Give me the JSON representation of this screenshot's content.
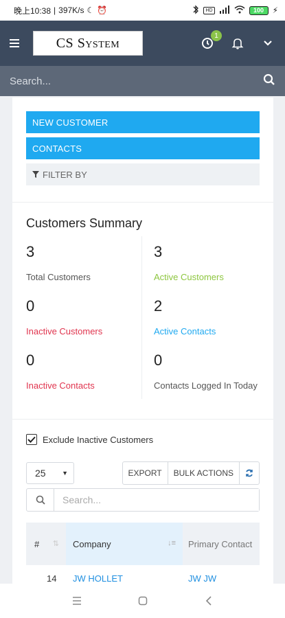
{
  "status_bar": {
    "time": "晚上10:38",
    "speed": "397K/s",
    "battery": "100",
    "network_badge": "HD"
  },
  "header": {
    "logo_text_cs": "CS",
    "logo_text_system": "System",
    "timer_badge": "1"
  },
  "search": {
    "placeholder": "Search..."
  },
  "actions": {
    "new_customer": "NEW CUSTOMER",
    "contacts": "CONTACTS",
    "filter_by": "FILTER BY"
  },
  "summary": {
    "title": "Customers Summary",
    "stats": [
      {
        "value": "3",
        "label": "Total Customers"
      },
      {
        "value": "3",
        "label": "Active Customers"
      },
      {
        "value": "0",
        "label": "Inactive Customers"
      },
      {
        "value": "2",
        "label": "Active Contacts"
      },
      {
        "value": "0",
        "label": "Inactive Contacts"
      },
      {
        "value": "0",
        "label": "Contacts Logged In Today"
      }
    ]
  },
  "table": {
    "exclude_label": "Exclude Inactive Customers",
    "exclude_checked": true,
    "page_size": "25",
    "export": "EXPORT",
    "bulk_actions": "BULK ACTIONS",
    "search_placeholder": "Search...",
    "columns": [
      "#",
      "Company",
      "Primary Contact"
    ],
    "rows": [
      {
        "id": "14",
        "company": "JW HOLLET",
        "contact": "JW JW"
      }
    ]
  },
  "colors": {
    "header_bg": "#3c4a5e",
    "accent_blue": "#1fa9f0",
    "green": "#8dc63f",
    "red": "#e0344e"
  }
}
